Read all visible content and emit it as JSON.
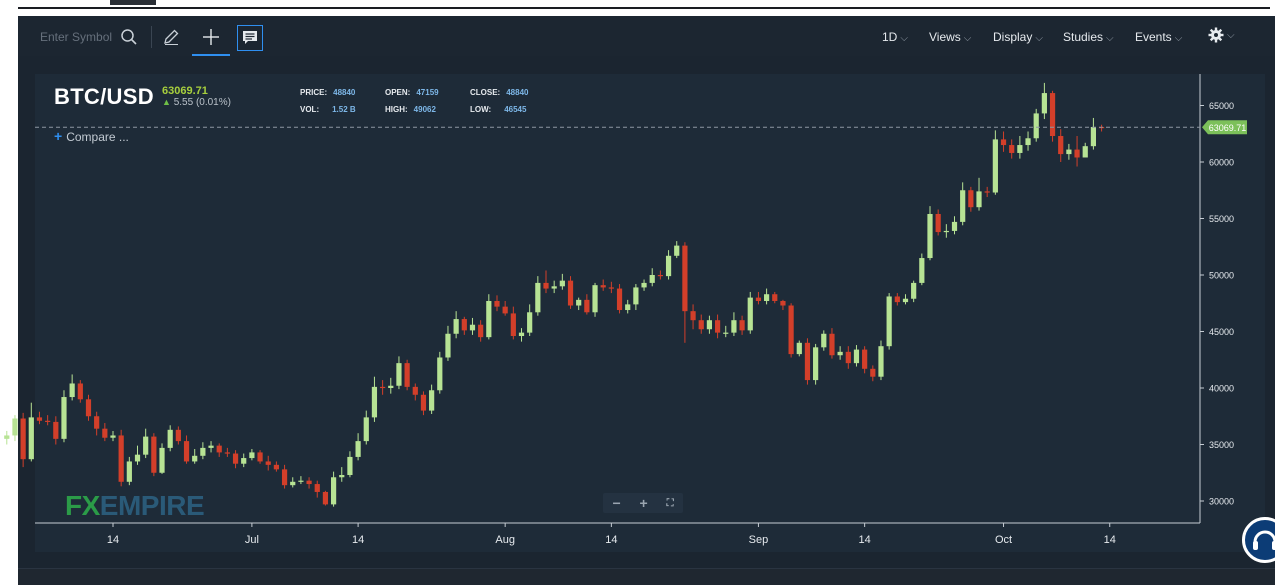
{
  "toolbar": {
    "symbol_placeholder": "Enter Symbol",
    "icons": [
      "search-icon",
      "pencil-icon",
      "crosshair-icon",
      "comment-icon",
      "gear-icon"
    ],
    "menus": {
      "period": "1D",
      "views": "Views",
      "display": "Display",
      "studies": "Studies",
      "events": "Events"
    },
    "chevron": "⌵"
  },
  "header": {
    "symbol": "BTC/USD",
    "last_price": "63069.71",
    "change": "5.55 (0.01%)",
    "stats": {
      "price_label": "PRICE:",
      "price": "48840",
      "open_label": "OPEN:",
      "open": "47159",
      "close_label": "CLOSE:",
      "close": "48840",
      "vol_label": "VOL:",
      "vol": "1.52 B",
      "high_label": "HIGH:",
      "high": "49062",
      "low_label": "LOW:",
      "low": "46545"
    }
  },
  "compare_label": "Compare ...",
  "zoom": {
    "minus": "−",
    "plus": "+",
    "fit": "⛶"
  },
  "watermark": {
    "fx": "FX",
    "empire": "EMPIRE"
  },
  "colors": {
    "up": "#b7e394",
    "down": "#d33f2a",
    "price_tag": "#7cc05a",
    "background": "#1e2b38",
    "accent": "#2f8ff0",
    "price_text": "#a7cf3d"
  },
  "chart_data": {
    "type": "candlestick",
    "title": "BTC/USD",
    "current_price": 63069.71,
    "current_price_label": "63069.71",
    "ylim": [
      28000,
      67500
    ],
    "yticks": [
      30000,
      35000,
      40000,
      45000,
      50000,
      55000,
      60000,
      65000
    ],
    "ytick_labels": [
      "30000",
      "35000",
      "40000",
      "45000",
      "50000",
      "55000",
      "60000",
      "65000"
    ],
    "xticks": [
      {
        "label": "14",
        "date": "2021-06-14"
      },
      {
        "label": "Jul",
        "date": "2021-07-01"
      },
      {
        "label": "14",
        "date": "2021-07-14"
      },
      {
        "label": "Aug",
        "date": "2021-08-01"
      },
      {
        "label": "14",
        "date": "2021-08-14"
      },
      {
        "label": "Sep",
        "date": "2021-09-01"
      },
      {
        "label": "14",
        "date": "2021-09-14"
      },
      {
        "label": "Oct",
        "date": "2021-10-01"
      },
      {
        "label": "14",
        "date": "2021-10-14"
      }
    ],
    "start_date": "2021-06-01",
    "close": [
      35800,
      37300,
      33700,
      37400,
      37100,
      37000,
      35500,
      39200,
      40400,
      39000,
      37500,
      36400,
      35600,
      35800,
      31700,
      33500,
      34100,
      35700,
      32500,
      34700,
      36300,
      35300,
      33500,
      34000,
      34700,
      34900,
      34300,
      34200,
      33300,
      33800,
      34300,
      33500,
      33200,
      32800,
      31400,
      31700,
      31800,
      31500,
      30800,
      29700,
      32100,
      32300,
      33900,
      35300,
      37400,
      40100,
      40000,
      40200,
      42200,
      40100,
      39400,
      38000,
      39800,
      42700,
      44800,
      46100,
      45100,
      45600,
      44500,
      47700,
      47200,
      46600,
      44600,
      44900,
      46700,
      49300,
      48800,
      49000,
      49500,
      47300,
      47800,
      46700,
      49100,
      48900,
      48800,
      46900,
      47400,
      48900,
      49300,
      50000,
      49900,
      51700,
      52600,
      46800,
      46000,
      45200,
      46000,
      44900,
      44900,
      46000,
      45100,
      48000,
      47700,
      48300,
      47700,
      47300,
      43000,
      44000,
      40700,
      43600,
      44800,
      42900,
      43200,
      42200,
      43400,
      41700,
      41000,
      43700,
      48100,
      47600,
      47900,
      49300,
      51500,
      55400,
      53800,
      53900,
      54700,
      57500,
      56000,
      57400,
      57300,
      62000,
      61500,
      60800,
      61500,
      62100,
      64300,
      66100,
      62300,
      60700,
      61100,
      60400,
      61400,
      63100,
      63070
    ],
    "open": [
      35500,
      35800,
      37300,
      33700,
      37400,
      37100,
      37000,
      35500,
      39200,
      40400,
      39000,
      37500,
      36400,
      35600,
      35800,
      31700,
      33500,
      34100,
      35700,
      32500,
      34700,
      36300,
      35300,
      33500,
      34000,
      34700,
      34900,
      34300,
      34200,
      33300,
      33800,
      34300,
      33500,
      33200,
      32800,
      31400,
      31700,
      31800,
      31500,
      30800,
      29700,
      32100,
      32300,
      33900,
      35300,
      37400,
      40100,
      40000,
      40200,
      42200,
      40100,
      39400,
      38000,
      39800,
      42700,
      44800,
      46100,
      45100,
      45600,
      44500,
      47700,
      47200,
      46600,
      44600,
      44900,
      46700,
      49300,
      48800,
      49000,
      49500,
      47300,
      47800,
      46700,
      49100,
      48900,
      48800,
      46900,
      47400,
      48900,
      49300,
      50000,
      49900,
      51700,
      52600,
      46800,
      46000,
      45200,
      46000,
      44900,
      44900,
      46000,
      45100,
      48000,
      47700,
      48300,
      47700,
      47300,
      43000,
      44000,
      40700,
      43600,
      44800,
      42900,
      43200,
      42200,
      43400,
      41700,
      41000,
      43700,
      48100,
      47600,
      47900,
      49300,
      51500,
      55400,
      53800,
      53900,
      54700,
      57500,
      56000,
      57400,
      57300,
      62000,
      61500,
      60800,
      61500,
      62100,
      64300,
      66100,
      62300,
      60700,
      61100,
      60400,
      61400,
      63100
    ],
    "high": [
      36200,
      37600,
      37800,
      38700,
      37900,
      37600,
      37500,
      39800,
      41200,
      40700,
      39400,
      37900,
      36900,
      36200,
      36300,
      33900,
      34900,
      36400,
      36000,
      35100,
      36700,
      36600,
      35800,
      34600,
      35200,
      35300,
      35100,
      34700,
      34500,
      34200,
      34600,
      34500,
      34000,
      33500,
      33200,
      32100,
      32200,
      32100,
      31800,
      30900,
      32600,
      33000,
      34400,
      36000,
      38000,
      41000,
      40700,
      40900,
      42800,
      42500,
      40400,
      39700,
      40300,
      43200,
      45500,
      46800,
      46300,
      46200,
      46000,
      48300,
      48200,
      47700,
      47200,
      45300,
      47400,
      49900,
      50400,
      49500,
      50100,
      49900,
      48000,
      48300,
      49300,
      49600,
      49400,
      49200,
      47800,
      49200,
      49600,
      50600,
      50400,
      52200,
      53000,
      52900,
      47400,
      46500,
      46400,
      46500,
      45500,
      46700,
      46400,
      48500,
      48500,
      48800,
      48500,
      47800,
      47500,
      44200,
      44400,
      43900,
      45100,
      45300,
      43700,
      43700,
      43800,
      43700,
      42000,
      44200,
      48400,
      48400,
      48300,
      49500,
      51900,
      56100,
      55800,
      54500,
      55200,
      58200,
      57800,
      58600,
      57800,
      62800,
      62700,
      62000,
      62300,
      62700,
      64700,
      67000,
      66300,
      62900,
      61600,
      62300,
      61700,
      63900,
      63300
    ],
    "low": [
      35000,
      35300,
      33000,
      33500,
      36800,
      36700,
      35000,
      35200,
      38900,
      38700,
      37100,
      35800,
      35300,
      35300,
      31300,
      31400,
      33200,
      33800,
      32200,
      32400,
      34400,
      35000,
      33300,
      33300,
      33700,
      34300,
      33900,
      33900,
      32900,
      33000,
      33600,
      33300,
      32700,
      32600,
      31100,
      31200,
      31500,
      31100,
      30300,
      29600,
      29500,
      31700,
      32100,
      33600,
      35000,
      37000,
      39400,
      39500,
      39900,
      39800,
      38900,
      37600,
      37700,
      39500,
      42400,
      44400,
      44700,
      44700,
      44100,
      44300,
      46800,
      46400,
      44300,
      44100,
      44600,
      46400,
      48400,
      48400,
      48700,
      47000,
      46900,
      46500,
      46300,
      48600,
      48400,
      46600,
      46600,
      46900,
      48600,
      49000,
      49600,
      49600,
      51500,
      44000,
      45200,
      44800,
      44800,
      44400,
      44500,
      44600,
      44700,
      44800,
      47400,
      47400,
      47500,
      46900,
      42700,
      42800,
      40300,
      40300,
      43300,
      42600,
      42500,
      41700,
      41900,
      41300,
      40600,
      40700,
      43400,
      47300,
      47400,
      47600,
      49100,
      51300,
      53500,
      53300,
      53600,
      54400,
      55600,
      55700,
      56900,
      57100,
      60900,
      60300,
      60300,
      61000,
      61800,
      63800,
      61800,
      60000,
      60200,
      59600,
      60600,
      61100,
      62700
    ]
  }
}
